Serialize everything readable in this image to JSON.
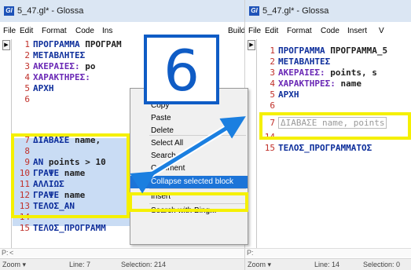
{
  "left_window": {
    "app_icon": "Gl",
    "title": "5_47.gl* - Glossa",
    "menu": [
      "File",
      "Edit",
      "Format",
      "Code",
      "Ins",
      "Build"
    ],
    "gutter_arrow": "▶",
    "code_lines": [
      {
        "num": "1",
        "parts": [
          {
            "t": "ΠΡΟΓΡΑΜΜΑ ",
            "c": "kw"
          },
          {
            "t": "ΠΡΟΓΡΑΜ",
            "c": "id"
          }
        ]
      },
      {
        "num": "2",
        "parts": [
          {
            "t": "ΜΕΤΑΒΛΗΤΕΣ",
            "c": "kw"
          }
        ]
      },
      {
        "num": "3",
        "parts": [
          {
            "t": "  ΑΚΕΡΑΙΕΣ: ",
            "c": "ty"
          },
          {
            "t": "po",
            "c": "id"
          }
        ]
      },
      {
        "num": "4",
        "parts": [
          {
            "t": "  ΧΑΡΑΚΤΗΡΕΣ:",
            "c": "ty"
          }
        ]
      },
      {
        "num": "5",
        "parts": [
          {
            "t": "ΑΡΧΗ",
            "c": "kw"
          }
        ]
      },
      {
        "num": "6",
        "parts": []
      },
      {
        "num": "7",
        "parts": [
          {
            "t": "ΔΙΑΒΑΣΕ ",
            "c": "kw"
          },
          {
            "t": "name,",
            "c": "id"
          }
        ]
      },
      {
        "num": "8",
        "parts": []
      },
      {
        "num": "9",
        "parts": [
          {
            "t": "ΑΝ ",
            "c": "kw"
          },
          {
            "t": "points > 10",
            "c": "id"
          }
        ]
      },
      {
        "num": "10",
        "parts": [
          {
            "t": "    ΓΡΑΨΕ ",
            "c": "kw"
          },
          {
            "t": "name",
            "c": "id"
          }
        ]
      },
      {
        "num": "11",
        "parts": [
          {
            "t": "ΑΛΛΙΩΣ",
            "c": "kw"
          }
        ]
      },
      {
        "num": "12",
        "parts": [
          {
            "t": "    ΓΡΑΨΕ ",
            "c": "kw"
          },
          {
            "t": "name",
            "c": "id"
          }
        ]
      },
      {
        "num": "13",
        "parts": [
          {
            "t": "ΤΕΛΟΣ_ΑΝ",
            "c": "kw"
          }
        ]
      },
      {
        "num": "14",
        "parts": []
      },
      {
        "num": "15",
        "parts": [
          {
            "t": "ΤΕΛΟΣ_ΠΡΟΓΡΑΜΜ",
            "c": "kw"
          }
        ]
      }
    ],
    "hscroll": {
      "p": "P:",
      "arrow": "<"
    },
    "status": {
      "zoom": "Zoom ▾",
      "line": "Line:  7",
      "selection": "Selection:  214"
    }
  },
  "context_menu": {
    "items": [
      {
        "label": "Cut",
        "underline": 0
      },
      {
        "label": "Copy",
        "underline": 0
      },
      {
        "label": "Paste",
        "underline": 0
      },
      {
        "label": "Delete",
        "underline": 0
      },
      {
        "label": "Select All",
        "underline": 0
      },
      {
        "label": "Search",
        "underline": 0
      },
      {
        "label": "Comment",
        "underline": 0
      },
      {
        "label": "Collapse selected block",
        "underline": 0,
        "highlighted": true
      },
      {
        "label": "Insert",
        "underline": 0
      },
      {
        "label": "Search with Bing...",
        "underline": 0
      }
    ]
  },
  "callout": {
    "step": "6"
  },
  "right_window": {
    "app_icon": "Gl",
    "title": "5_47.gl* - Glossa",
    "menu": [
      "File",
      "Edit",
      "Format",
      "Code",
      "Insert",
      "V"
    ],
    "gutter_arrow": "▶",
    "code_lines": [
      {
        "num": "1",
        "parts": [
          {
            "t": "ΠΡΟΓΡΑΜΜΑ ",
            "c": "kw"
          },
          {
            "t": "ΠΡΟΓΡΑΜΜΑ_5",
            "c": "id"
          }
        ]
      },
      {
        "num": "2",
        "parts": [
          {
            "t": "ΜΕΤΑΒΛΗΤΕΣ",
            "c": "kw"
          }
        ]
      },
      {
        "num": "3",
        "parts": [
          {
            "t": "  ΑΚΕΡΑΙΕΣ: ",
            "c": "ty"
          },
          {
            "t": "points, s",
            "c": "id"
          }
        ]
      },
      {
        "num": "4",
        "parts": [
          {
            "t": "  ΧΑΡΑΚΤΗΡΕΣ: ",
            "c": "ty"
          },
          {
            "t": "name",
            "c": "id"
          }
        ]
      },
      {
        "num": "5",
        "parts": [
          {
            "t": "ΑΡΧΗ",
            "c": "kw"
          }
        ]
      },
      {
        "num": "6",
        "parts": []
      },
      {
        "num": "7",
        "parts": [
          {
            "t": "ΔΙΑΒΑΣΕ name, points",
            "c": "collapsed"
          }
        ]
      },
      {
        "num": "14",
        "parts": []
      },
      {
        "num": "15",
        "parts": [
          {
            "t": "ΤΕΛΟΣ_ΠΡΟΓΡΑΜΜΑΤΟΣ",
            "c": "kw"
          }
        ]
      }
    ],
    "hscroll": {
      "p": "P:"
    },
    "status": {
      "zoom": "Zoom ▾",
      "line": "Line:  14",
      "selection": "Selection:  0"
    }
  },
  "colors": {
    "keyword": "#0d2e9b",
    "type": "#6a28b5",
    "line_number": "#c0302a",
    "selection": "#c9dcf4",
    "menu_highlight": "#1c74d8",
    "annotation_yellow": "#f5f000",
    "annotation_blue": "#0f5cc5",
    "arrow_blue": "#1b7fe0"
  }
}
